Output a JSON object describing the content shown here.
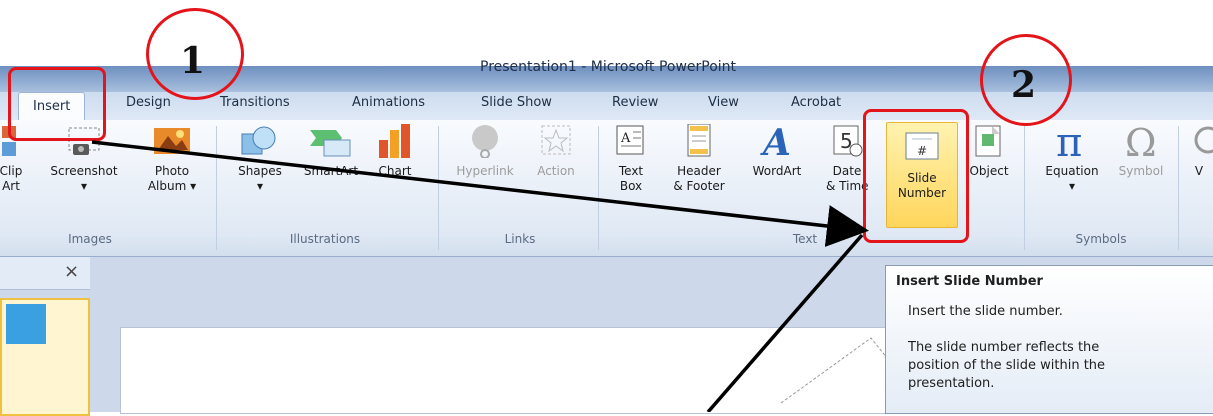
{
  "window": {
    "title": "Presentation1 - Microsoft PowerPoint"
  },
  "tabs": [
    {
      "label": "Insert"
    },
    {
      "label": "Design"
    },
    {
      "label": "Transitions"
    },
    {
      "label": "Animations"
    },
    {
      "label": "Slide Show"
    },
    {
      "label": "Review"
    },
    {
      "label": "View"
    },
    {
      "label": "Acrobat"
    }
  ],
  "ribbon": {
    "images": {
      "clip_line1": "Clip",
      "clip_line2": "Art",
      "screenshot": "Screenshot",
      "photo_line1": "Photo",
      "photo_line2": "Album ▾",
      "group": "Images"
    },
    "illustrations": {
      "shapes": "Shapes",
      "smartart": "SmartArt",
      "chart": "Chart",
      "group": "Illustrations"
    },
    "links": {
      "hyperlink": "Hyperlink",
      "action": "Action",
      "group": "Links"
    },
    "text": {
      "textbox_line1": "Text",
      "textbox_line2": "Box",
      "header_line1": "Header",
      "header_line2": "& Footer",
      "wordart": "WordArt",
      "date_line1": "Date",
      "date_line2": "& Time",
      "slidenum_line1": "Slide",
      "slidenum_line2": "Number",
      "object": "Object",
      "group": "Text"
    },
    "symbols": {
      "equation": "Equation",
      "symbol": "Symbol",
      "group": "Symbols"
    },
    "video": {
      "label": "V"
    }
  },
  "tooltip": {
    "title": "Insert Slide Number",
    "line1": "Insert the slide number.",
    "line2": "The slide number reflects the",
    "line3": "position of the slide within the",
    "line4": "presentation."
  },
  "callouts": {
    "one": "1",
    "two": "2"
  },
  "pane": {
    "close": "×"
  },
  "colors": {
    "annotation_red": "#e3141a",
    "ribbon_bg": "#dfe8f4",
    "highlight": "#ffd65c"
  }
}
